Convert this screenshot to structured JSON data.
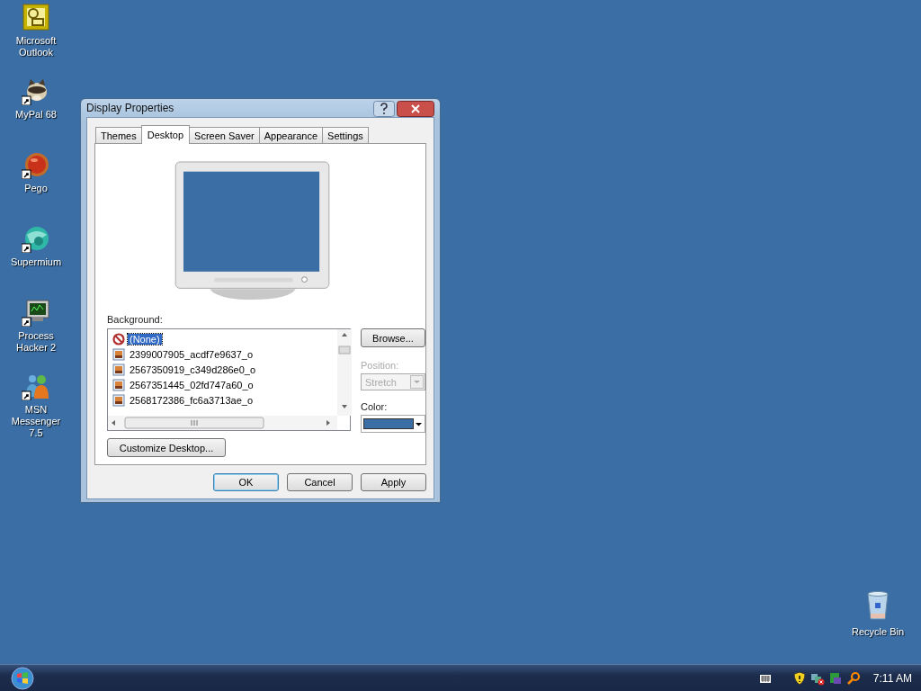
{
  "desktop_icons": [
    {
      "label": "Microsoft Outlook",
      "kind": "outlook",
      "shortcut": false
    },
    {
      "label": "MyPal 68",
      "kind": "animal",
      "shortcut": true
    },
    {
      "label": "Pego",
      "kind": "ball",
      "shortcut": true
    },
    {
      "label": "Supermium",
      "kind": "globe",
      "shortcut": true
    },
    {
      "label": "Process Hacker 2",
      "kind": "monitor",
      "shortcut": true
    },
    {
      "label": "MSN Messenger 7.5",
      "kind": "people",
      "shortcut": true
    }
  ],
  "recycle_bin": {
    "label": "Recycle Bin"
  },
  "window": {
    "title": "Display Properties"
  },
  "tabs": [
    {
      "label": "Themes",
      "selected": false
    },
    {
      "label": "Desktop",
      "selected": true
    },
    {
      "label": "Screen Saver",
      "selected": false
    },
    {
      "label": "Appearance",
      "selected": false
    },
    {
      "label": "Settings",
      "selected": false
    }
  ],
  "background": {
    "label": "Background:",
    "items": [
      {
        "label": "(None)",
        "kind": "none",
        "selected": true
      },
      {
        "label": "2399007905_acdf7e9637_o",
        "kind": "image",
        "selected": false
      },
      {
        "label": "2567350919_c349d286e0_o",
        "kind": "image",
        "selected": false
      },
      {
        "label": "2567351445_02fd747a60_o",
        "kind": "image",
        "selected": false
      },
      {
        "label": "2568172386_fc6a3713ae_o",
        "kind": "image",
        "selected": false
      }
    ]
  },
  "browse_button": "Browse...",
  "position": {
    "label": "Position:",
    "value": "Stretch",
    "disabled": true
  },
  "color": {
    "label": "Color:",
    "color": "#3a6ea5"
  },
  "customize_button": "Customize Desktop...",
  "buttons": [
    {
      "label": "OK",
      "default": true
    },
    {
      "label": "Cancel",
      "default": false
    },
    {
      "label": "Apply",
      "default": false
    }
  ],
  "taskbar": {
    "clock": "7:11 AM"
  }
}
